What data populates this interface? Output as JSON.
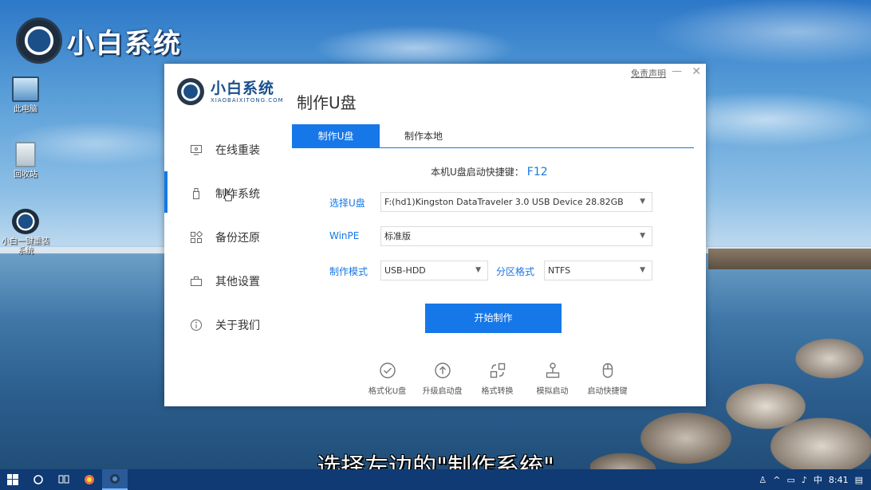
{
  "desktop": {
    "brand_name": "小白系统",
    "icons": [
      {
        "label": "此电脑"
      },
      {
        "label": "回收站"
      },
      {
        "label": "小白一键重装系统"
      }
    ]
  },
  "window": {
    "logo_cn": "小白系统",
    "logo_en": "XIAOBAIXITONG.COM",
    "page_title": "制作U盘",
    "disclaimer": "免责声明",
    "minimize": "—",
    "close": "✕"
  },
  "sidebar": {
    "items": [
      {
        "label": "在线重装",
        "icon": "monitor-icon",
        "active": false
      },
      {
        "label": "制作系统",
        "icon": "usb-icon",
        "active": true
      },
      {
        "label": "备份还原",
        "icon": "grid-icon",
        "active": false
      },
      {
        "label": "其他设置",
        "icon": "briefcase-icon",
        "active": false
      },
      {
        "label": "关于我们",
        "icon": "info-icon",
        "active": false
      }
    ]
  },
  "tabs": [
    {
      "label": "制作U盘",
      "active": true
    },
    {
      "label": "制作本地",
      "active": false
    }
  ],
  "shortcut": {
    "label": "本机U盘启动快捷键：",
    "key": "F12"
  },
  "form": {
    "usb_label": "选择U盘",
    "usb_value": "F:(hd1)Kingston DataTraveler 3.0 USB Device 28.82GB",
    "winpe_label": "WinPE",
    "winpe_value": "标准版",
    "mode_label": "制作模式",
    "mode_value": "USB-HDD",
    "partition_label": "分区格式",
    "partition_value": "NTFS"
  },
  "start_button": "开始制作",
  "tools": [
    {
      "label": "格式化U盘",
      "icon": "check-circle-icon"
    },
    {
      "label": "升级启动盘",
      "icon": "arrow-up-circle-icon"
    },
    {
      "label": "格式转换",
      "icon": "convert-icon"
    },
    {
      "label": "模拟启动",
      "icon": "joystick-icon"
    },
    {
      "label": "启动快捷键",
      "icon": "mouse-icon"
    }
  ],
  "subtitle": "选择左边的\"制作系统\"",
  "taskbar": {
    "time": "8:41",
    "ime": "中"
  },
  "colors": {
    "accent": "#1677e8",
    "taskbar": "#0f3a73"
  }
}
